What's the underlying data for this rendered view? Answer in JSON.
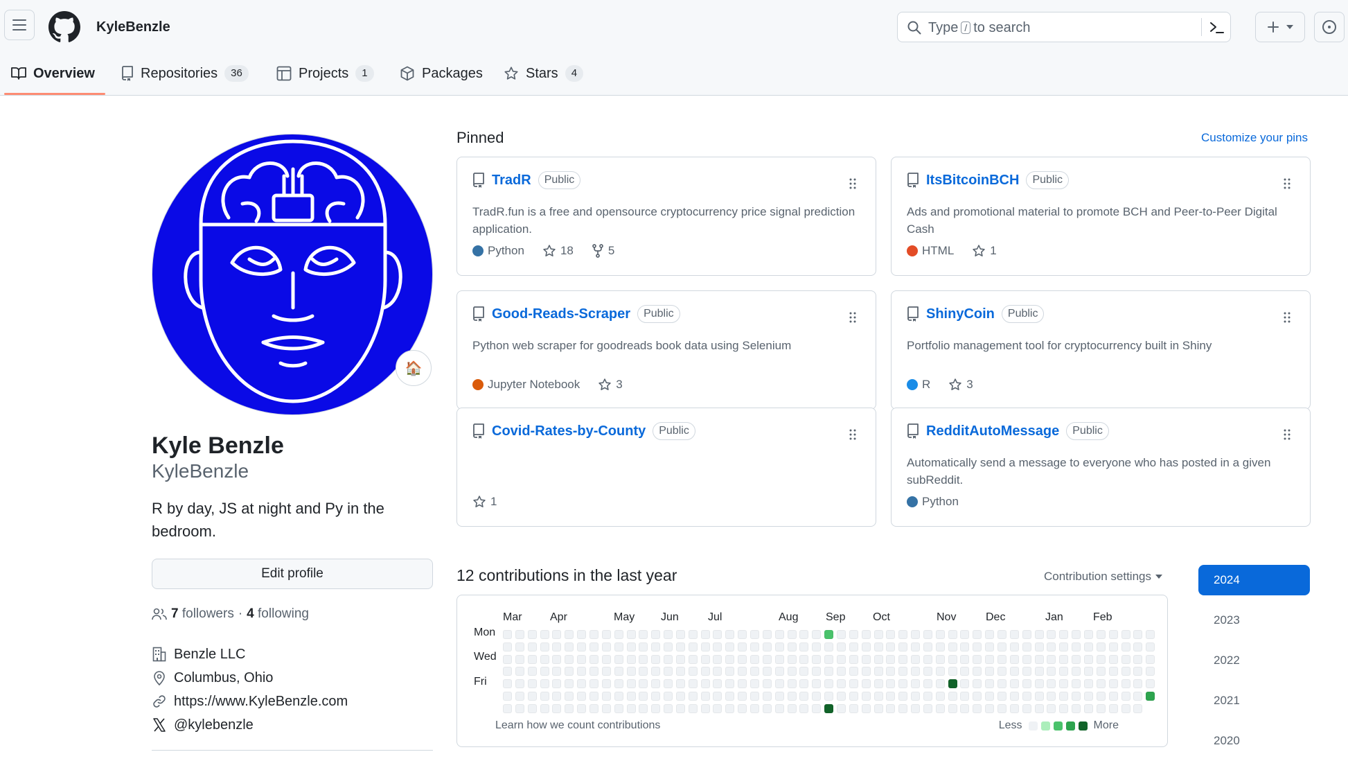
{
  "header": {
    "username": "KyleBenzle",
    "search": {
      "prefix": "Type",
      "key": "/",
      "suffix": "to search"
    }
  },
  "tabs": [
    {
      "label": "Overview",
      "count": null
    },
    {
      "label": "Repositories",
      "count": "36"
    },
    {
      "label": "Projects",
      "count": "1"
    },
    {
      "label": "Packages",
      "count": null
    },
    {
      "label": "Stars",
      "count": "4"
    }
  ],
  "profile": {
    "full_name": "Kyle Benzle",
    "login": "KyleBenzle",
    "bio": "R by day, JS at night and Py in the bedroom.",
    "status_emoji": "🏠",
    "edit_label": "Edit profile",
    "followers_count": "7",
    "followers_label": "followers",
    "separator": "·",
    "following_count": "4",
    "following_label": "following",
    "company": "Benzle LLC",
    "location": "Columbus, Ohio",
    "website": "https://www.KyleBenzle.com",
    "twitter": "@kylebenzle"
  },
  "pinned": {
    "title": "Pinned",
    "customize_label": "Customize your pins",
    "repos": [
      {
        "name": "TradR",
        "visibility": "Public",
        "description": "TradR.fun is a free and opensource cryptocurrency price signal prediction application.",
        "language": "Python",
        "lang_color": "#3572A5",
        "stars": "18",
        "forks": "5"
      },
      {
        "name": "ItsBitcoinBCH",
        "visibility": "Public",
        "description": "Ads and promotional material to promote BCH and Peer-to-Peer Digital Cash",
        "language": "HTML",
        "lang_color": "#e34c26",
        "stars": "1",
        "forks": null
      },
      {
        "name": "Good-Reads-Scraper",
        "visibility": "Public",
        "description": "Python web scraper for goodreads book data using Selenium",
        "language": "Jupyter Notebook",
        "lang_color": "#DA5B0B",
        "stars": "3",
        "forks": null
      },
      {
        "name": "ShinyCoin",
        "visibility": "Public",
        "description": "Portfolio management tool for cryptocurrency built in Shiny",
        "language": "R",
        "lang_color": "#198CE7",
        "stars": "3",
        "forks": null
      },
      {
        "name": "Covid-Rates-by-County",
        "visibility": "Public",
        "description": "",
        "language": null,
        "lang_color": null,
        "stars": "1",
        "forks": null
      },
      {
        "name": "RedditAutoMessage",
        "visibility": "Public",
        "description": "Automatically send a message to everyone who has posted in a given subReddit.",
        "language": "Python",
        "lang_color": "#3572A5",
        "stars": null,
        "forks": null
      }
    ]
  },
  "contributions": {
    "title": "12 contributions in the last year",
    "settings_label": "Contribution settings",
    "months": [
      "Mar",
      "Apr",
      "May",
      "Jun",
      "Jul",
      "Aug",
      "Sep",
      "Oct",
      "Nov",
      "Dec",
      "Jan",
      "Feb"
    ],
    "day_labels": [
      "Mon",
      "Wed",
      "Fri"
    ],
    "learn_label": "Learn how we count contributions",
    "legend_less": "Less",
    "legend_more": "More",
    "legend_colors": [
      "#eff2f5",
      "#aceebb",
      "#4ac26b",
      "#2da44e",
      "#116329"
    ],
    "weeks": 53,
    "last_week_days": 5,
    "active_cells": [
      {
        "week": 26,
        "day": 0,
        "level": 2
      },
      {
        "week": 36,
        "day": 4,
        "level": 4
      },
      {
        "week": 26,
        "day": 6,
        "level": 4
      },
      {
        "week": 52,
        "day": 5,
        "level": 3
      }
    ]
  },
  "years": [
    "2024",
    "2023",
    "2022",
    "2021",
    "2020"
  ],
  "colors": {
    "link": "#0969da",
    "accent_underline": "#fd8c73",
    "avatar_bg": "#0a0ae6"
  }
}
